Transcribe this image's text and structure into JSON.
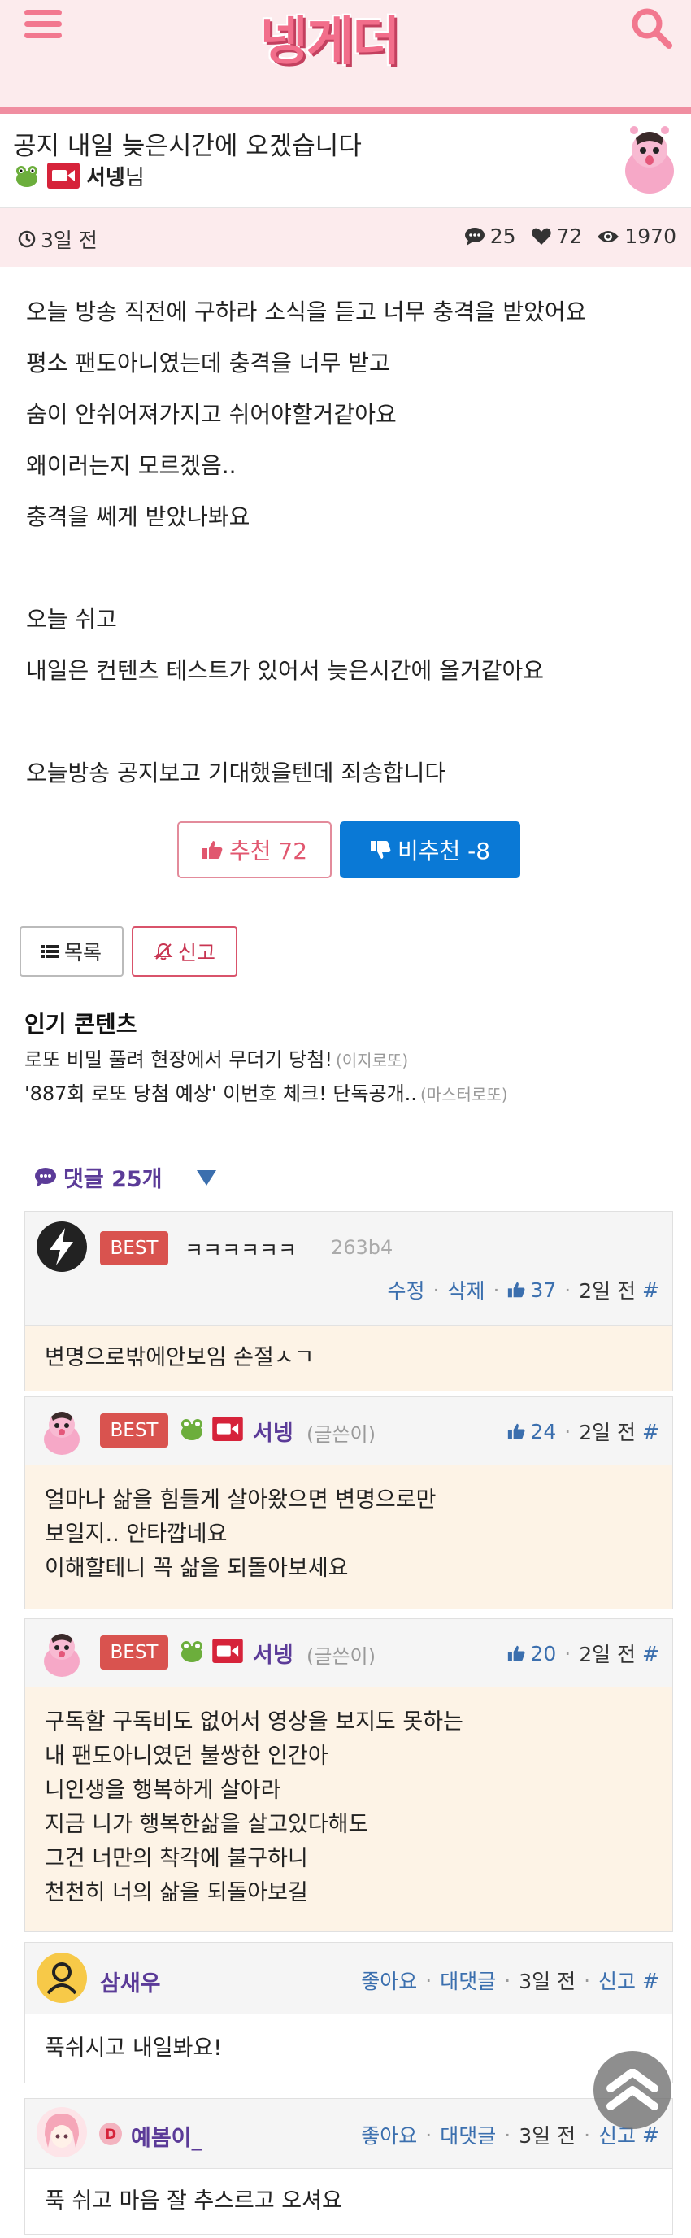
{
  "header": {
    "logo_text": "넹게더",
    "menu_icon": "hamburger-menu-icon",
    "search_icon": "search-icon",
    "accent_color": "#f26e8b"
  },
  "post": {
    "title": "공지 내일 늦은시간에 오겠습니다",
    "author_name": "서넹",
    "author_suffix": "님",
    "time_ago": "3일 전",
    "comment_count": "25",
    "like_count": "72",
    "view_count": "1970",
    "body_lines": [
      "오늘 방송 직전에 구하라 소식을 듣고 너무 충격을 받았어요",
      "평소 팬도아니였는데 충격을 너무 받고",
      "숨이 안쉬어져가지고 쉬어야할거같아요",
      "왜이러는지 모르겠음..",
      "충격을 쎄게 받았나봐요",
      "",
      "오늘 쉬고",
      "내일은 컨텐츠 테스트가 있어서 늦은시간에 올거같아요",
      "",
      "오늘방송 공지보고 기대했을텐데 죄송합니다"
    ],
    "upvote_label": "추천 72",
    "downvote_label": "비추천 -8",
    "list_label": "목록",
    "report_label": "신고"
  },
  "popular": {
    "title": "인기 콘텐츠",
    "items": [
      {
        "text": "로또 비밀 풀려 현장에서 무더기 당첨!",
        "source": "(이지로또)"
      },
      {
        "text": "'887회 로또 당첨 예상' 이번호 체크! 단독공개..",
        "source": "(마스터로또)"
      }
    ]
  },
  "comments_section": {
    "label": "댓글 25개",
    "comments": [
      {
        "best": "BEST",
        "inline_text": "ㅋㅋㅋㅋㅋㅋ",
        "id": "263b4",
        "edit": "수정",
        "delete": "삭제",
        "likes": "37",
        "time": "2일 전",
        "hash": "#",
        "lines": [
          "변명으로밖에안보임 손절ㅅㄱ"
        ]
      },
      {
        "best": "BEST",
        "name": "서넹",
        "writer": "(글쓴이)",
        "likes": "24",
        "time": "2일 전",
        "hash": "#",
        "lines": [
          "얼마나 삶을 힘들게 살아왔으면 변명으로만",
          "보일지.. 안타깝네요",
          "이해할테니 꼭 삶을 되돌아보세요"
        ]
      },
      {
        "best": "BEST",
        "name": "서넹",
        "writer": "(글쓴이)",
        "likes": "20",
        "time": "2일 전",
        "hash": "#",
        "lines": [
          "구독할 구독비도 없어서 영상을 보지도 못하는",
          "내 팬도아니였던 불쌍한 인간아",
          "니인생을 행복하게 살아라",
          "지금 니가 행복한삶을 살고있다해도",
          "그건 너만의 착각에 불구하니",
          "천천히 너의 삶을 되돌아보길"
        ]
      },
      {
        "name": "삼새우",
        "like_label": "좋아요",
        "reply_label": "대댓글",
        "time": "3일 전",
        "report": "신고",
        "hash": "#",
        "lines": [
          "푹쉬시고 내일봐요!"
        ]
      },
      {
        "name": "예봄이_",
        "like_label": "좋아요",
        "reply_label": "대댓글",
        "time": "3일 전",
        "report": "신고",
        "hash": "#",
        "lines": [
          "푹 쉬고 마음 잘 추스르고 오셔요"
        ]
      }
    ]
  }
}
